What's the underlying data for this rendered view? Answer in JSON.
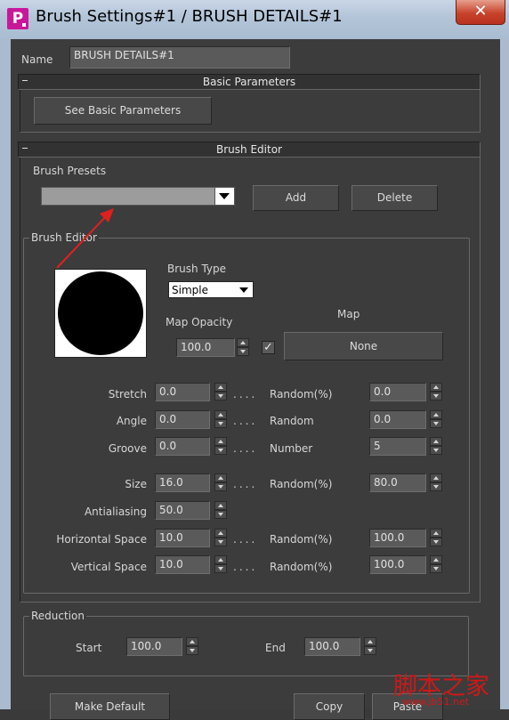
{
  "window": {
    "title": "Brush Settings#1 / BRUSH DETAILS#1",
    "close_glyph": "✕",
    "app_icon_letter": "P"
  },
  "name_row": {
    "label": "Name",
    "value": "BRUSH DETAILS#1"
  },
  "basic_parameters": {
    "header": "Basic Parameters",
    "button": "See Basic Parameters"
  },
  "brush_editor_rollout": {
    "header": "Brush Editor",
    "presets_label": "Brush Presets",
    "presets_value": "",
    "add_button": "Add",
    "delete_button": "Delete"
  },
  "brush_editor_group": {
    "title": "Brush Editor",
    "brush_type_label": "Brush Type",
    "brush_type_value": "Simple",
    "map_opacity_label": "Map Opacity",
    "map_opacity_value": "100.0",
    "map_opacity_checked": true,
    "map_label": "Map",
    "map_button": "None",
    "dots": "....",
    "params": {
      "stretch": {
        "label": "Stretch",
        "value": "0.0",
        "secondary_label": "Random(%)",
        "secondary_value": "0.0"
      },
      "angle": {
        "label": "Angle",
        "value": "0.0",
        "secondary_label": "Random",
        "secondary_value": "0.0"
      },
      "groove": {
        "label": "Groove",
        "value": "0.0",
        "secondary_label": "Number",
        "secondary_value": "5"
      },
      "size": {
        "label": "Size",
        "value": "16.0",
        "secondary_label": "Random(%)",
        "secondary_value": "80.0"
      },
      "antialiasing": {
        "label": "Antialiasing",
        "value": "50.0"
      },
      "horizontal_space": {
        "label": "Horizontal Space",
        "value": "10.0",
        "secondary_label": "Random(%)",
        "secondary_value": "100.0"
      },
      "vertical_space": {
        "label": "Vertical Space",
        "value": "10.0",
        "secondary_label": "Random(%)",
        "secondary_value": "100.0"
      }
    }
  },
  "reduction": {
    "title": "Reduction",
    "start_label": "Start",
    "start_value": "100.0",
    "end_label": "End",
    "end_value": "100.0"
  },
  "bottom_buttons": {
    "make_default": "Make Default",
    "copy": "Copy",
    "paste": "Paste"
  },
  "watermark": {
    "text": "脚本之家",
    "url": "www.jb51.net"
  },
  "colors": {
    "annotation_arrow": "#e02020",
    "title_bar": "#b3c4d8",
    "close_button": "#c8432c",
    "panel": "#3c3c3c"
  }
}
